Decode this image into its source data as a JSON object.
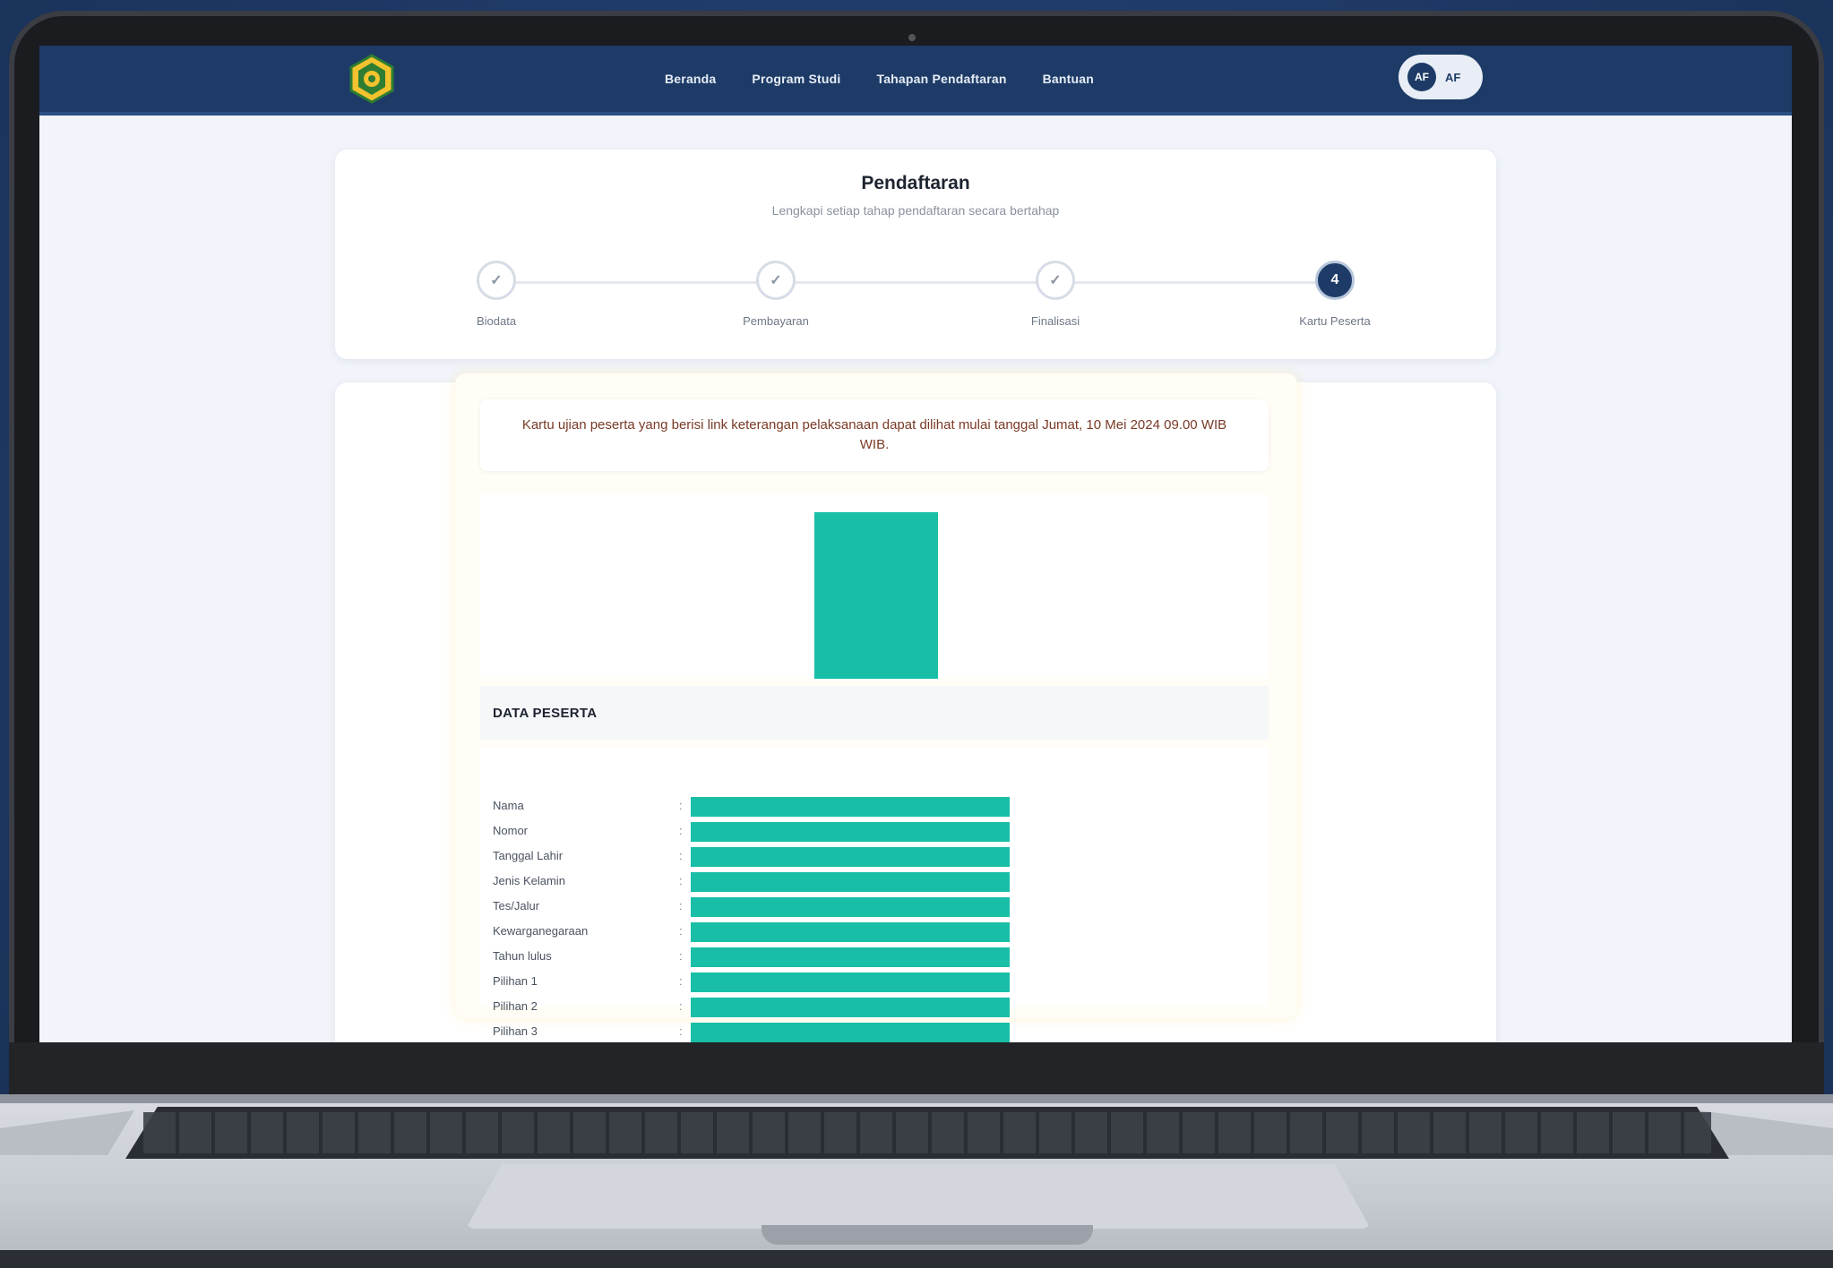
{
  "colors": {
    "navbar": "#1d3b66",
    "accent_teal": "#18bfa6",
    "step_active": "#1d3b66",
    "notice_text": "#7a3a26"
  },
  "navbar": {
    "logo_icon": "institution-crest-logo",
    "links": [
      "Beranda",
      "Program Studi",
      "Tahapan Pendaftaran",
      "Bantuan"
    ],
    "user": {
      "avatar_initials": "AF",
      "name": "AF"
    }
  },
  "header": {
    "title": "Pendaftaran",
    "subtitle": "Lengkapi setiap tahap pendaftaran secara bertahap"
  },
  "steps": [
    {
      "symbol": "✓",
      "label": "Biodata",
      "state": "done"
    },
    {
      "symbol": "✓",
      "label": "Pembayaran",
      "state": "done"
    },
    {
      "symbol": "✓",
      "label": "Finalisasi",
      "state": "done"
    },
    {
      "symbol": "4",
      "label": "Kartu Peserta",
      "state": "active"
    }
  ],
  "ticket": {
    "notice": "Kartu ujian peserta yang berisi link keterangan pelaksanaan dapat dilihat mulai tanggal Jumat, 10 Mei 2024 09.00 WIB WIB.",
    "section_title": "DATA PESERTA",
    "rows": [
      {
        "label": "Nama"
      },
      {
        "label": "Nomor"
      },
      {
        "label": "Tanggal Lahir"
      },
      {
        "label": "Jenis Kelamin"
      },
      {
        "label": "Tes/Jalur"
      },
      {
        "label": "Kewarganegaraan"
      },
      {
        "label": "Tahun lulus"
      },
      {
        "label": "Pilihan 1"
      },
      {
        "label": "Pilihan 2"
      },
      {
        "label": "Pilihan 3"
      }
    ]
  }
}
